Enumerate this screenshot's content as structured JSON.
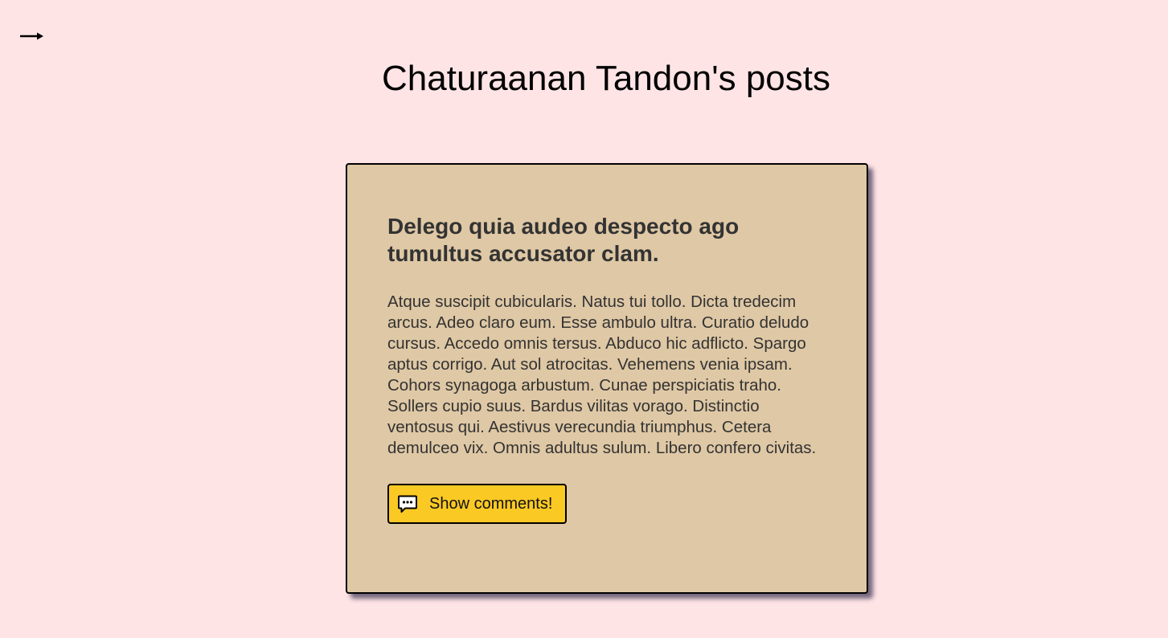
{
  "nav": {
    "toggle_icon": "arrow-right-icon"
  },
  "page": {
    "title": "Chaturaanan Tandon's posts"
  },
  "post": {
    "title": "Delego quia audeo despecto ago tumultus accusator clam.",
    "body": "Atque suscipit cubicularis. Natus tui tollo. Dicta tredecim arcus. Adeo claro eum. Esse ambulo ultra. Curatio deludo cursus. Accedo omnis tersus. Abduco hic adflicto. Spargo aptus corrigo. Aut sol atrocitas. Vehemens venia ipsam. Cohors synagoga arbustum. Cunae perspiciatis traho. Sollers cupio suus. Bardus vilitas vorago. Distinctio ventosus qui. Aestivus verecundia triumphus. Cetera demulceo vix. Omnis adultus sulum. Libero confero civitas.",
    "comments_button_label": "Show comments!",
    "comments_icon": "comment-bubble-icon"
  },
  "colors": {
    "background": "#ffe4e6",
    "card": "#dfc8a5",
    "button": "#fbc924"
  }
}
